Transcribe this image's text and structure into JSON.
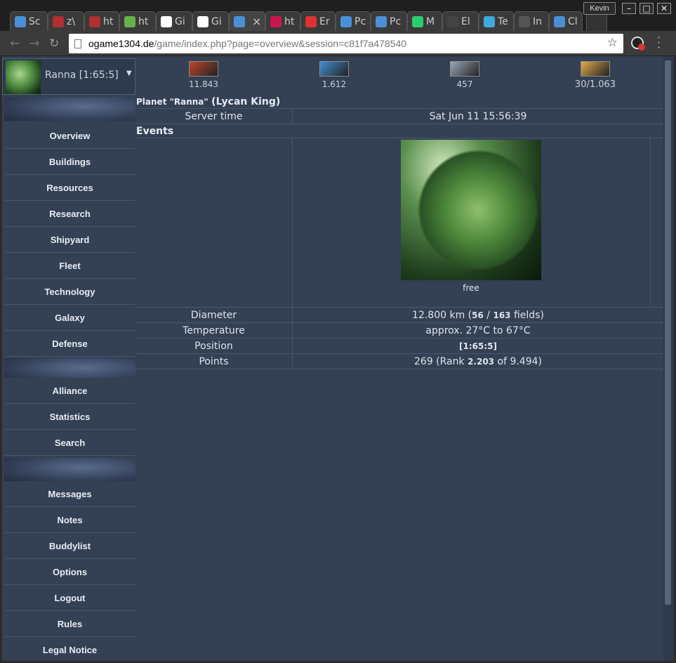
{
  "browser": {
    "user_name": "Kevin",
    "tabs": [
      {
        "label": "Sc",
        "icon": "s-logo-icon",
        "color": "#4a8fd8"
      },
      {
        "label": "z\\",
        "icon": "question-icon",
        "color": "#b03030"
      },
      {
        "label": "ht",
        "icon": "question-icon",
        "color": "#b03030"
      },
      {
        "label": "ht",
        "icon": "shield-icon",
        "color": "#6ab04c"
      },
      {
        "label": "Gi",
        "icon": "google-icon",
        "color": "#ffffff"
      },
      {
        "label": "Gi",
        "icon": "github-icon",
        "color": "#ffffff"
      },
      {
        "label": "",
        "icon": "ogame-icon",
        "color": "#4a8fd8",
        "active": true
      },
      {
        "label": "ht",
        "icon": "yt-icon",
        "color": "#c8174f"
      },
      {
        "label": "Er",
        "icon": "mail-icon",
        "color": "#d33"
      },
      {
        "label": "Pc",
        "icon": "ogame-icon",
        "color": "#4a8fd8"
      },
      {
        "label": "Pc",
        "icon": "ogame-icon",
        "color": "#4a8fd8"
      },
      {
        "label": "M",
        "icon": "m-icon",
        "color": "#2ecc71"
      },
      {
        "label": "El",
        "icon": "blank-icon",
        "color": "#444444"
      },
      {
        "label": "Te",
        "icon": "drupal-icon",
        "color": "#3fa8e0"
      },
      {
        "label": "In",
        "icon": "doc-icon",
        "color": "#555555"
      },
      {
        "label": "Cl",
        "icon": "ogame-icon",
        "color": "#4a8fd8"
      }
    ],
    "url_host": "ogame1304.de",
    "url_path": "/game/index.php?page=overview&session=c81f7a478540"
  },
  "sidebar": {
    "planet_selector": "Ranna [1:65:5]",
    "group1": [
      "Overview",
      "Buildings",
      "Resources",
      "Research",
      "Shipyard",
      "Fleet",
      "Technology",
      "Galaxy",
      "Defense"
    ],
    "group2": [
      "Alliance",
      "Statistics",
      "Search"
    ],
    "group3": [
      "Messages",
      "Notes",
      "Buddylist",
      "Options",
      "Logout",
      "Rules",
      "Legal Notice"
    ]
  },
  "resources": [
    {
      "name": "metal",
      "value": "11.843",
      "icon": "metal-icon",
      "color": "#c0442a"
    },
    {
      "name": "crystal",
      "value": "1.612",
      "icon": "crystal-icon",
      "color": "#3f8fd0"
    },
    {
      "name": "deuterium",
      "value": "457",
      "icon": "deuterium-icon",
      "color": "#9aa6b8"
    },
    {
      "name": "energy",
      "value": "30/1.063",
      "icon": "energy-icon",
      "color": "#e0a84a"
    }
  ],
  "overview": {
    "planet_title_small": "Planet \"Ranna\"",
    "planet_title_owner": "(Lycan King)",
    "server_time_label": "Server time",
    "server_time_value": "Sat Jun 11 15:56:39",
    "events_heading": "Events",
    "planet_status": "free",
    "diameter_label": "Diameter",
    "diameter_prefix": "12.800 km (",
    "fields_used": "56",
    "fields_sep": " / ",
    "fields_total": "163",
    "diameter_suffix": " fields)",
    "temperature_label": "Temperature",
    "temperature_value": "approx. 27°C to 67°C",
    "position_label": "Position",
    "position_value": "[1:65:5]",
    "points_label": "Points",
    "points_prefix": "269 (Rank ",
    "points_rank": "2.203",
    "points_suffix": " of 9.494)"
  }
}
